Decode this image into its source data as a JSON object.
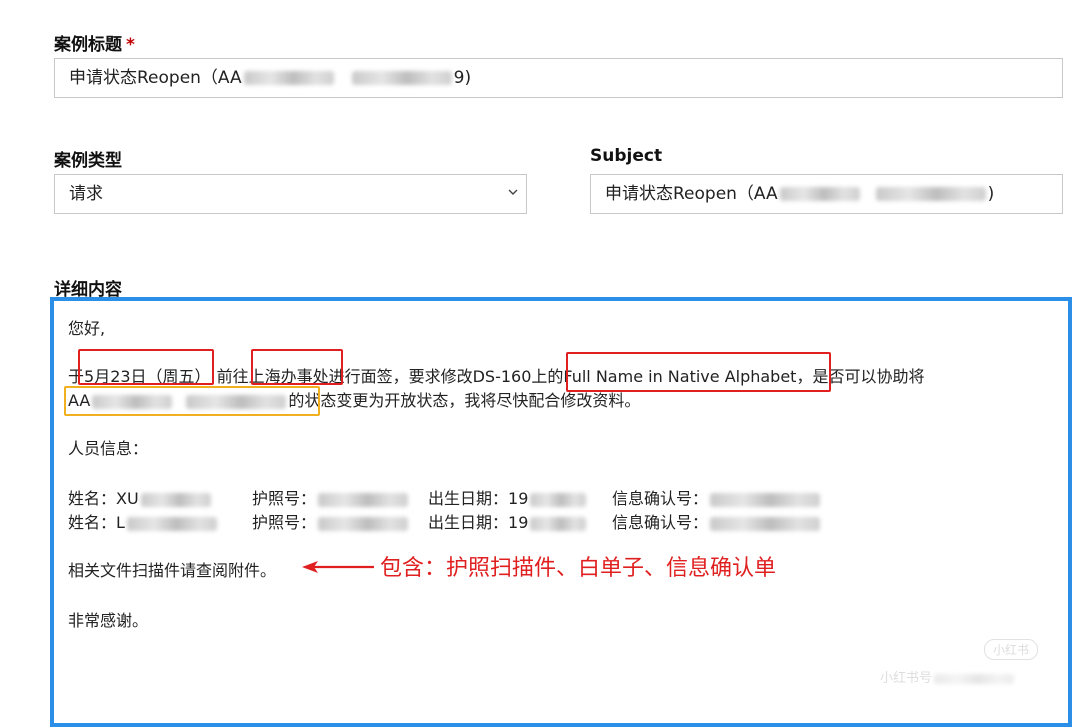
{
  "form": {
    "case_title_label": "案例标题",
    "required_mark": "*",
    "case_title_prefix": "申请状态Reopen（AA",
    "case_title_suffix": "9)",
    "case_type_label": "案例类型",
    "case_type_value": "请求",
    "subject_label": "Subject",
    "subject_prefix": "申请状态Reopen（AA",
    "subject_suffix": ")",
    "details_label": "详细内容"
  },
  "message": {
    "greeting": "您好,",
    "l1_a": "于",
    "l1_date": "5月23日（周五）",
    "l1_b": "前往",
    "l1_place": "上海办事处",
    "l1_c": "进行面签，要求修改DS-160上的",
    "l1_field": "Full Name in Native Alphabet",
    "l1_d": "，是否可以协助将",
    "l2_prefix": "AA",
    "l2_rest": "的状态变更为开放状态，我将尽快配合修改资料。",
    "personnel_heading": "人员信息：",
    "persons": [
      {
        "name_label": "姓名：",
        "name_prefix": "XU",
        "passport_label": "护照号：",
        "dob_label": "出生日期：",
        "dob_prefix": "19",
        "confirm_label": "信息确认号："
      },
      {
        "name_label": "姓名：",
        "name_prefix": "L",
        "passport_label": "护照号：",
        "dob_label": "出生日期：",
        "dob_prefix": "19",
        "confirm_label": "信息确认号："
      }
    ],
    "attachments_line": "相关文件扫描件请查阅附件。",
    "thanks": "非常感谢。"
  },
  "annotation": {
    "text": "包含：护照扫描件、白单子、信息确认单",
    "color": "#e02020"
  },
  "watermark": {
    "badge": "小红书",
    "text": "小红书号"
  },
  "colors": {
    "textarea_border": "#2b8fe8",
    "highlight_red": "#e02020",
    "highlight_yellow": "#f0b020"
  }
}
